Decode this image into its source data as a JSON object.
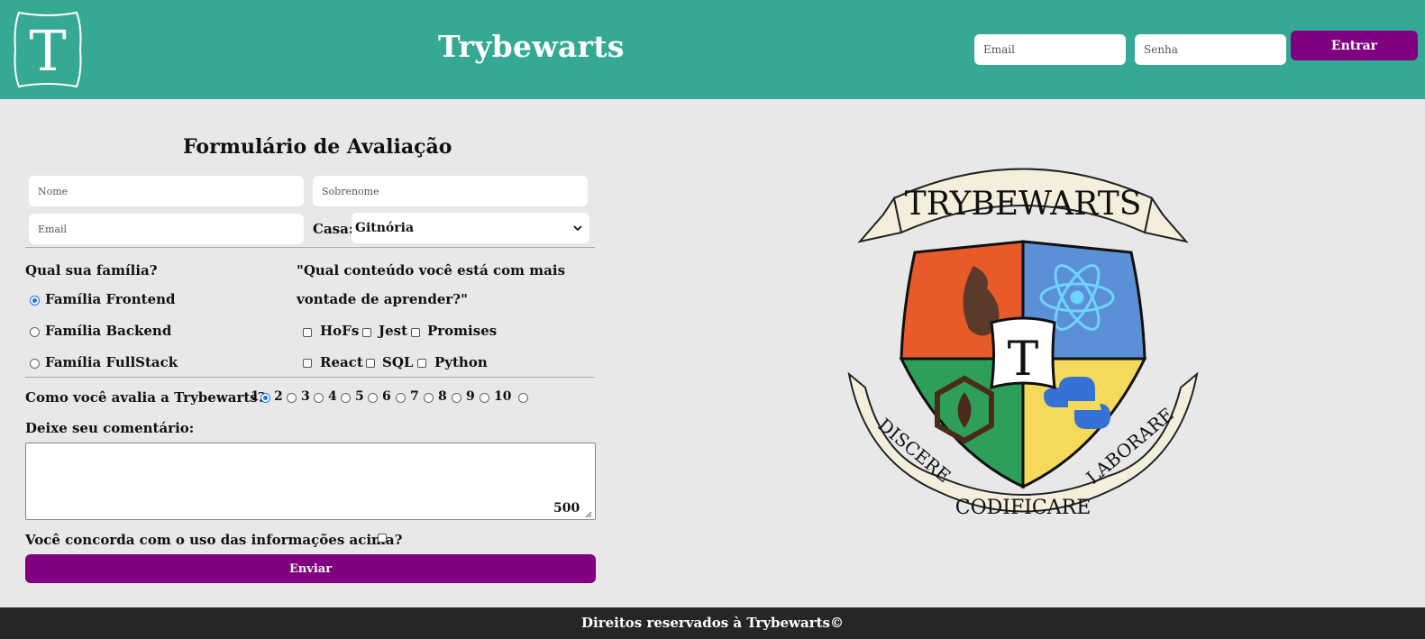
{
  "header": {
    "logo_letter": "T",
    "title": "Trybewarts",
    "email_placeholder": "Email",
    "password_placeholder": "Senha",
    "login_label": "Entrar"
  },
  "form": {
    "title": "Formulário de Avaliação",
    "name_placeholder": "Nome",
    "surname_placeholder": "Sobrenome",
    "email_placeholder": "Email",
    "house_label": "Casa:",
    "house_selected": "Gitnória",
    "family_question": "Qual sua família?",
    "families": [
      {
        "label": "Família Frontend",
        "checked": true
      },
      {
        "label": "Família Backend",
        "checked": false
      },
      {
        "label": "Família FullStack",
        "checked": false
      }
    ],
    "content_question_line1": "\"Qual conteúdo você está com mais",
    "content_question_line2": "vontade de aprender?\"",
    "subjects": [
      "HoFs",
      "Jest",
      "Promises",
      "React",
      "SQL",
      "Python"
    ],
    "rating_label": "Como você avalia a Trybewarts?",
    "ratings": [
      "1",
      "2",
      "3",
      "4",
      "5",
      "6",
      "7",
      "8",
      "9",
      "10"
    ],
    "rating_selected": "1",
    "comment_label": "Deixe seu comentário:",
    "char_counter": "500",
    "agreement_label": "Você concorda com o uso das informações acima?",
    "submit_label": "Enviar"
  },
  "crest": {
    "banner_top": "TRYBEWARTS",
    "center_letter": "T",
    "motto_left": "DISCERE",
    "motto_center": "CODIFICARE",
    "motto_right": "LABORARE"
  },
  "footer": {
    "text": "Direitos reservados à Trybewarts©"
  },
  "colors": {
    "header_bg": "#35a994",
    "button_purple": "#800080",
    "page_bg": "#e8e8e8",
    "footer_bg": "#262626"
  }
}
